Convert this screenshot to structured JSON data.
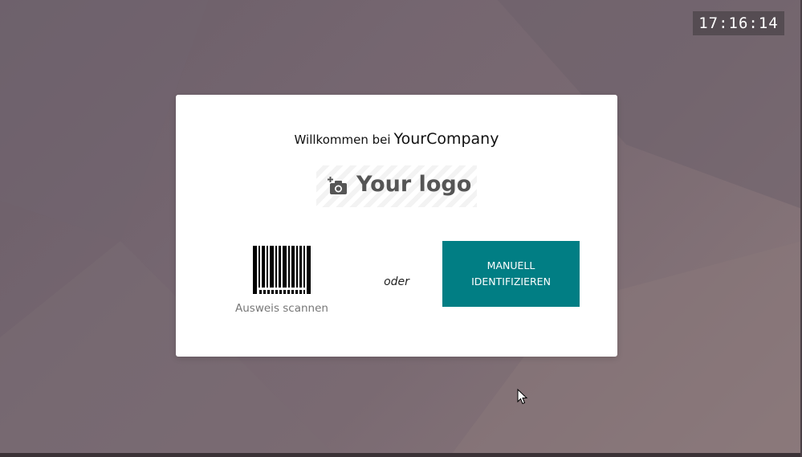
{
  "clock": {
    "time": "17:16:14"
  },
  "welcome": {
    "prefix": "Willkommen bei",
    "company": "YourCompany"
  },
  "logo": {
    "text": "Your logo",
    "icon": "add-camera-icon"
  },
  "scan": {
    "label": "Ausweis scannen",
    "icon": "barcode-icon"
  },
  "divider": {
    "text": "oder"
  },
  "manual_button": {
    "label": "MANUELL\nIDENTIFIZIEREN"
  },
  "colors": {
    "accent": "#017e84",
    "card_bg": "#ffffff",
    "clock_bg": "#50484e"
  }
}
